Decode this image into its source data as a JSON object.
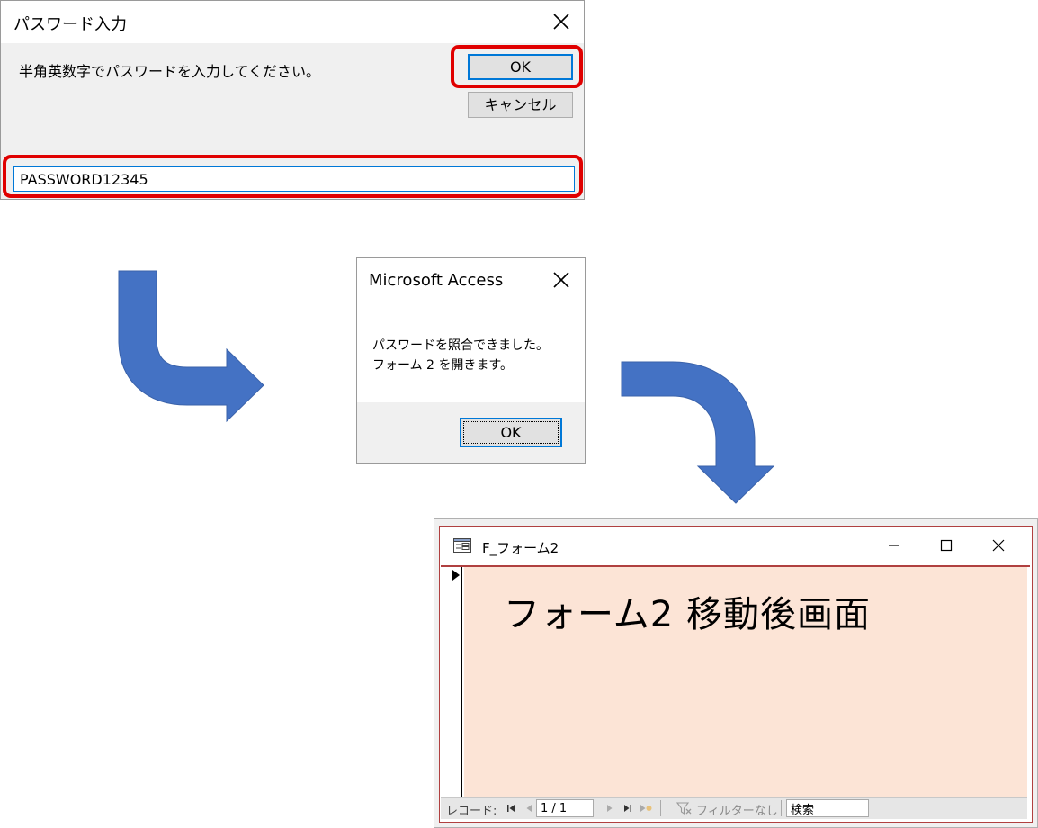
{
  "password_dialog": {
    "title": "パスワード入力",
    "message": "半角英数字でパスワードを入力してください。",
    "ok_label": "OK",
    "cancel_label": "キャンセル",
    "input_value": "PASSWORD12345",
    "close_icon": "close-icon"
  },
  "access_dialog": {
    "title": "Microsoft Access",
    "message_line1": "パスワードを照合できました。",
    "message_line2": "フォーム 2 を開きます。",
    "ok_label": "OK"
  },
  "form2": {
    "title": "F_フォーム2",
    "heading": "フォーム2 移動後画面",
    "nav": {
      "record_label": "レコード:",
      "counter": "1 / 1",
      "filter_label": "フィルターなし",
      "search_value": "検索"
    }
  },
  "colors": {
    "arrow_blue": "#4472c4",
    "highlight_red": "#e00000",
    "form_background": "#fce4d6",
    "focus_blue": "#0078d7"
  }
}
